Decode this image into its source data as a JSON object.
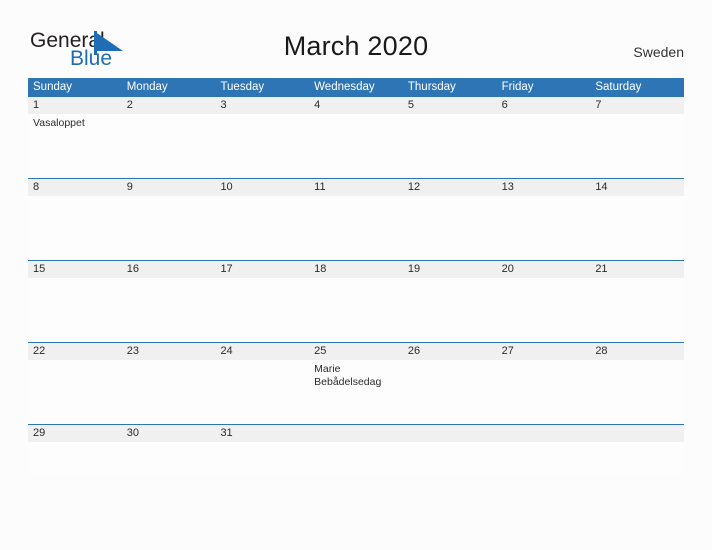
{
  "brand": {
    "name_part1": "General",
    "name_part2": "Blue",
    "logo_icon": "blue-triangle-flag-icon",
    "color_primary": "#1f6db5",
    "color_text": "#231f20"
  },
  "header": {
    "title": "March 2020",
    "country": "Sweden"
  },
  "calendar": {
    "accent_color": "#2e75b6",
    "date_band_color": "#f0f0f0",
    "weekdays": [
      "Sunday",
      "Monday",
      "Tuesday",
      "Wednesday",
      "Thursday",
      "Friday",
      "Saturday"
    ],
    "weeks": [
      {
        "days": [
          {
            "date": "1",
            "event": "Vasaloppet"
          },
          {
            "date": "2",
            "event": ""
          },
          {
            "date": "3",
            "event": ""
          },
          {
            "date": "4",
            "event": ""
          },
          {
            "date": "5",
            "event": ""
          },
          {
            "date": "6",
            "event": ""
          },
          {
            "date": "7",
            "event": ""
          }
        ]
      },
      {
        "days": [
          {
            "date": "8",
            "event": ""
          },
          {
            "date": "9",
            "event": ""
          },
          {
            "date": "10",
            "event": ""
          },
          {
            "date": "11",
            "event": ""
          },
          {
            "date": "12",
            "event": ""
          },
          {
            "date": "13",
            "event": ""
          },
          {
            "date": "14",
            "event": ""
          }
        ]
      },
      {
        "days": [
          {
            "date": "15",
            "event": ""
          },
          {
            "date": "16",
            "event": ""
          },
          {
            "date": "17",
            "event": ""
          },
          {
            "date": "18",
            "event": ""
          },
          {
            "date": "19",
            "event": ""
          },
          {
            "date": "20",
            "event": ""
          },
          {
            "date": "21",
            "event": ""
          }
        ]
      },
      {
        "days": [
          {
            "date": "22",
            "event": ""
          },
          {
            "date": "23",
            "event": ""
          },
          {
            "date": "24",
            "event": ""
          },
          {
            "date": "25",
            "event": "Marie Bebådelsedag"
          },
          {
            "date": "26",
            "event": ""
          },
          {
            "date": "27",
            "event": ""
          },
          {
            "date": "28",
            "event": ""
          }
        ]
      },
      {
        "days": [
          {
            "date": "29",
            "event": ""
          },
          {
            "date": "30",
            "event": ""
          },
          {
            "date": "31",
            "event": ""
          },
          {
            "date": "",
            "event": ""
          },
          {
            "date": "",
            "event": ""
          },
          {
            "date": "",
            "event": ""
          },
          {
            "date": "",
            "event": ""
          }
        ]
      }
    ]
  }
}
